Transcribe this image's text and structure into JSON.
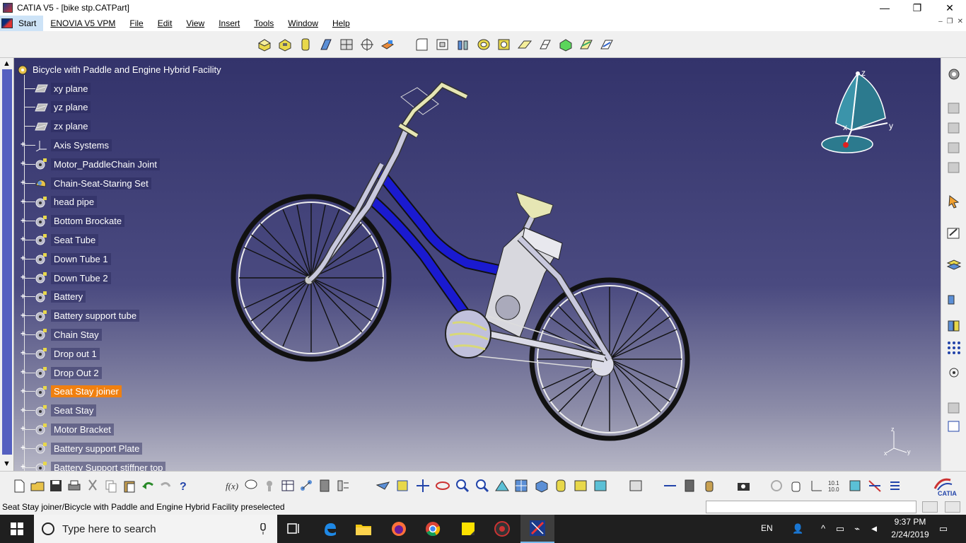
{
  "window": {
    "title": "CATIA V5 - [bike stp.CATPart]",
    "minimize": "—",
    "maximize": "❐",
    "close": "✕"
  },
  "menu": {
    "items": [
      "Start",
      "ENOVIA V5 VPM",
      "File",
      "Edit",
      "View",
      "Insert",
      "Tools",
      "Window",
      "Help"
    ],
    "mdi": [
      "–",
      "❐",
      "✕"
    ]
  },
  "tree": {
    "root": "Bicycle with Paddle and Engine Hybrid Facility",
    "items": [
      {
        "label": "xy plane",
        "icon": "plane-icon",
        "expandable": false
      },
      {
        "label": "yz plane",
        "icon": "plane-icon",
        "expandable": false
      },
      {
        "label": "zx plane",
        "icon": "plane-icon",
        "expandable": false
      },
      {
        "label": "Axis Systems",
        "icon": "axis-system-icon",
        "expandable": true
      },
      {
        "label": "Motor_PaddleChain Joint",
        "icon": "body-icon",
        "expandable": true
      },
      {
        "label": "Chain-Seat-Staring Set",
        "icon": "geometrical-set-icon",
        "expandable": true
      },
      {
        "label": "head pipe",
        "icon": "body-icon",
        "expandable": true
      },
      {
        "label": "Bottom Brockate",
        "icon": "body-icon",
        "expandable": true
      },
      {
        "label": "Seat Tube",
        "icon": "body-icon",
        "expandable": true
      },
      {
        "label": "Down Tube 1",
        "icon": "body-icon",
        "expandable": true
      },
      {
        "label": "Down Tube 2",
        "icon": "body-icon",
        "expandable": true
      },
      {
        "label": "Battery",
        "icon": "body-icon",
        "expandable": true
      },
      {
        "label": "Battery support tube",
        "icon": "body-icon",
        "expandable": true
      },
      {
        "label": "Chain Stay",
        "icon": "body-icon",
        "expandable": true
      },
      {
        "label": "Drop out 1",
        "icon": "body-icon",
        "expandable": true
      },
      {
        "label": "Drop Out 2",
        "icon": "body-icon",
        "expandable": true
      },
      {
        "label": "Seat Stay joiner",
        "icon": "body-icon",
        "expandable": true,
        "selected": true
      },
      {
        "label": "Seat Stay",
        "icon": "body-icon",
        "expandable": true
      },
      {
        "label": "Motor Bracket",
        "icon": "body-icon",
        "expandable": true
      },
      {
        "label": "Battery support Plate",
        "icon": "body-icon",
        "expandable": true
      },
      {
        "label": "Battery Support stiffner top",
        "icon": "body-icon",
        "expandable": true
      }
    ]
  },
  "compass": {
    "x": "x",
    "y": "y",
    "z": "z"
  },
  "status": {
    "message": "Seat Stay joiner/Bicycle with Paddle and Engine Hybrid Facility preselected",
    "command_value": ""
  },
  "taskbar": {
    "search_placeholder": "Type here to search",
    "language": "EN",
    "time": "9:37 PM",
    "date": "2/24/2019"
  },
  "colors": {
    "viewport_top": "#33336b",
    "viewport_bottom": "#b7b7c6",
    "selection": "#f08010",
    "frame_blue": "#1a1ad0"
  }
}
